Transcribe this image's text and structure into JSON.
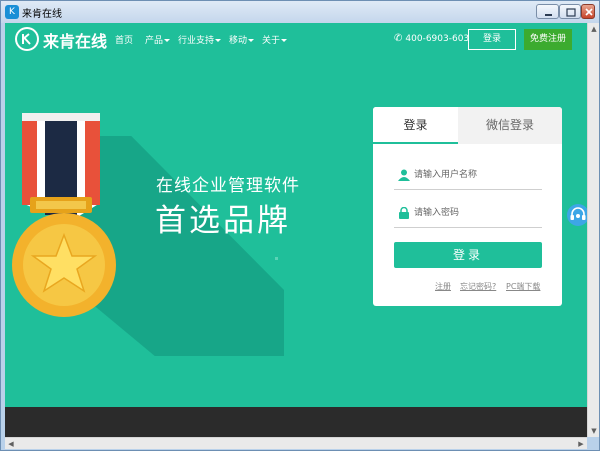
{
  "window": {
    "title": "来肯在线",
    "app_icon_glyph": "K"
  },
  "nav": {
    "logo_text": "来肯在线",
    "items": [
      {
        "label": "首页",
        "has_caret": false
      },
      {
        "label": "产品",
        "has_caret": true
      },
      {
        "label": "行业支持",
        "has_caret": true
      },
      {
        "label": "移动",
        "has_caret": true
      },
      {
        "label": "关于",
        "has_caret": true
      }
    ],
    "phone": "400-6903-603",
    "phone_icon": "phone-icon",
    "login_label": "登录",
    "register_label": "免费注册"
  },
  "hero": {
    "slogan_line1": "在线企业管理软件",
    "slogan_line2": "首选品牌",
    "medal_icon": "medal-icon"
  },
  "login_card": {
    "tab_login": "登录",
    "tab_wechat": "微信登录",
    "username_placeholder": "请输入用户名称",
    "password_placeholder": "请输入密码",
    "submit_label": "登录",
    "links": {
      "register": "注册",
      "forgot": "忘记密码?",
      "pc_download": "PC端下载"
    }
  },
  "colors": {
    "brand_green": "#1fbf9a",
    "register_green": "#3cab2f",
    "footer_dark": "#2b2b2b",
    "service_blue": "#3da6e6"
  }
}
